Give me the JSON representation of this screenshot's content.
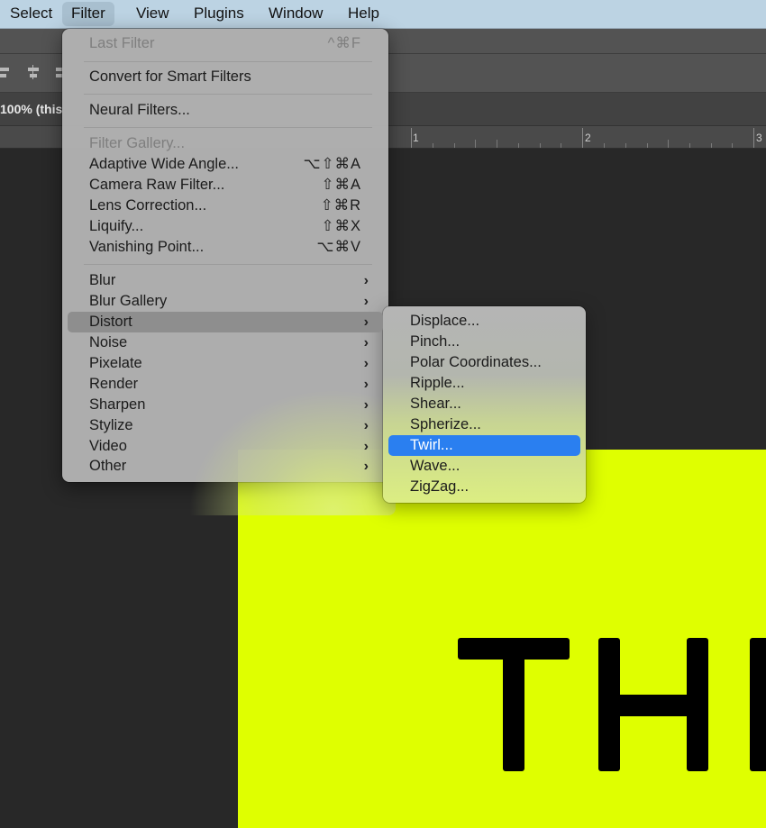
{
  "menubar": {
    "items": [
      {
        "label": "Select"
      },
      {
        "label": "Filter",
        "active": true
      },
      {
        "label": "View"
      },
      {
        "label": "Plugins"
      },
      {
        "label": "Window"
      },
      {
        "label": "Help"
      }
    ]
  },
  "document": {
    "tab_label": "100% (this",
    "ruler_labels": [
      "1",
      "2",
      "3"
    ],
    "canvas_color": "#dfff00",
    "canvas_text": "THI"
  },
  "filter_menu": {
    "items": [
      {
        "label": "Last Filter",
        "shortcut": "^⌘F",
        "disabled": true
      },
      {
        "label": "Convert for Smart Filters"
      },
      {
        "label": "Neural Filters..."
      },
      {
        "label": "Filter Gallery...",
        "disabled": true
      },
      {
        "label": "Adaptive Wide Angle...",
        "shortcut": "⌥⇧⌘A"
      },
      {
        "label": "Camera Raw Filter...",
        "shortcut": "⇧⌘A"
      },
      {
        "label": "Lens Correction...",
        "shortcut": "⇧⌘R"
      },
      {
        "label": "Liquify...",
        "shortcut": "⇧⌘X"
      },
      {
        "label": "Vanishing Point...",
        "shortcut": "⌥⌘V"
      },
      {
        "label": "Blur",
        "submenu": true
      },
      {
        "label": "Blur Gallery",
        "submenu": true
      },
      {
        "label": "Distort",
        "submenu": true,
        "highlighted": true
      },
      {
        "label": "Noise",
        "submenu": true
      },
      {
        "label": "Pixelate",
        "submenu": true
      },
      {
        "label": "Render",
        "submenu": true
      },
      {
        "label": "Sharpen",
        "submenu": true
      },
      {
        "label": "Stylize",
        "submenu": true
      },
      {
        "label": "Video",
        "submenu": true
      },
      {
        "label": "Other",
        "submenu": true
      }
    ],
    "chevron": "›"
  },
  "distort_submenu": {
    "items": [
      {
        "label": "Displace..."
      },
      {
        "label": "Pinch..."
      },
      {
        "label": "Polar Coordinates..."
      },
      {
        "label": "Ripple..."
      },
      {
        "label": "Shear..."
      },
      {
        "label": "Spherize..."
      },
      {
        "label": "Twirl...",
        "selected": true
      },
      {
        "label": "Wave..."
      },
      {
        "label": "ZigZag..."
      }
    ],
    "selection_color": "#2a7ff0"
  }
}
